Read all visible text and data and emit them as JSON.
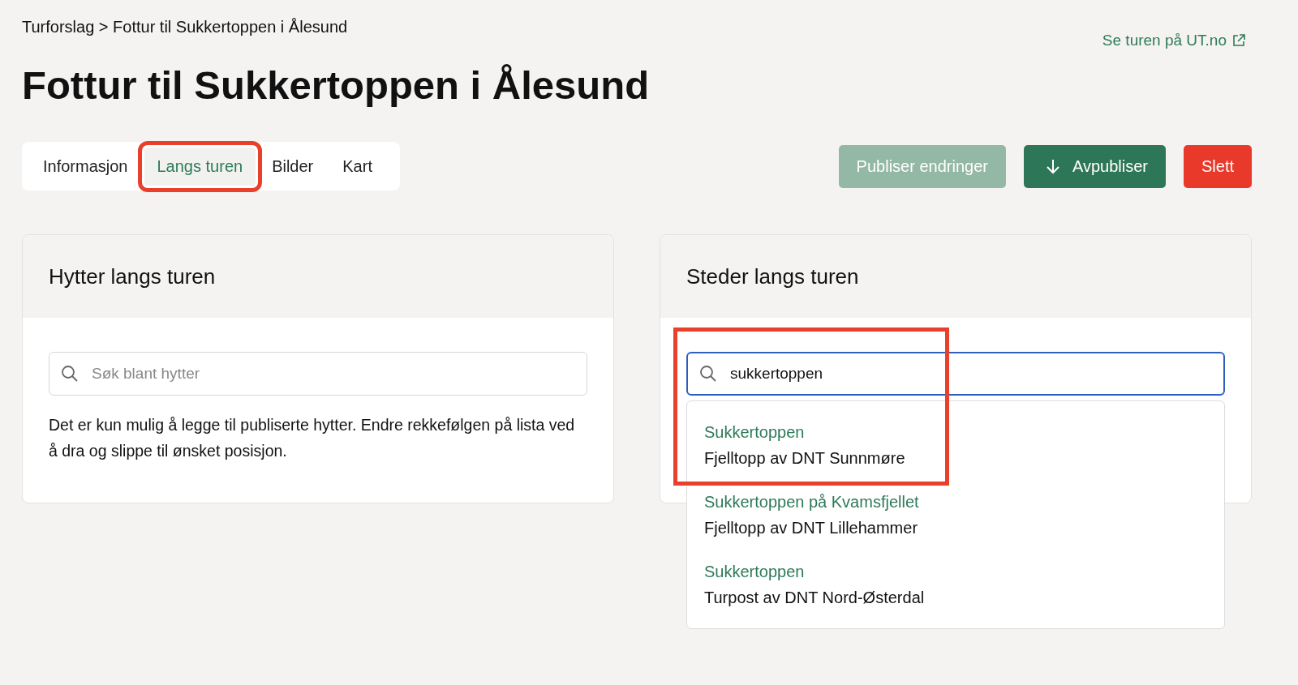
{
  "breadcrumb": "Turforslag > Fottur til Sukkertoppen i Ålesund",
  "external_link": "Se turen på UT.no",
  "title": "Fottur til Sukkertoppen i Ålesund",
  "tabs": [
    {
      "label": "Informasjon",
      "selected": false,
      "highlighted": false
    },
    {
      "label": "Langs turen",
      "selected": true,
      "highlighted": true
    },
    {
      "label": "Bilder",
      "selected": false,
      "highlighted": false
    },
    {
      "label": "Kart",
      "selected": false,
      "highlighted": false
    }
  ],
  "actions": [
    {
      "label": "Publiser endringer",
      "kind": "muted"
    },
    {
      "label": "Avpubliser",
      "kind": "primary"
    },
    {
      "label": "Slett",
      "kind": "danger"
    }
  ],
  "cabins_card": {
    "title": "Hytter langs turen",
    "search": {
      "placeholder": "Søk blant hytter"
    },
    "help": "Det er kun mulig å legge til publiserte hytter. Endre rekkefølgen på lista ved å dra og slippe til ønsket posisjon."
  },
  "places_card": {
    "title": "Steder langs turen",
    "search": {
      "value": "sukkertoppen",
      "focused": true
    },
    "results": [
      {
        "name": "Sukkertoppen",
        "description": "Fjelltopp av DNT Sunnmøre",
        "highlighted": true
      },
      {
        "name": "Sukkertoppen på Kvamsfjellet",
        "description": "Fjelltopp av DNT Lillehammer",
        "highlighted": false
      },
      {
        "name": "Sukkertoppen",
        "description": "Turpost av DNT Nord-Østerdal",
        "highlighted": false
      }
    ]
  }
}
